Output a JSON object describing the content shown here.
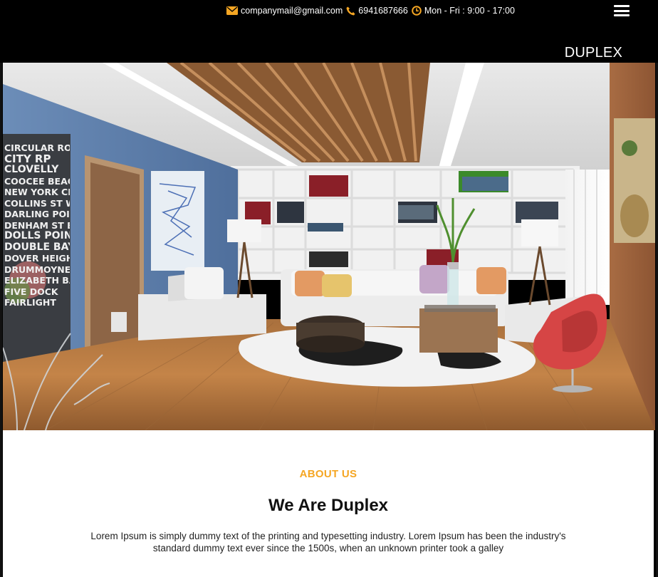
{
  "topbar": {
    "email": "companymail@gmail.com",
    "phone": "6941687666",
    "hours": "Mon - Fri : 9:00 - 17:00",
    "brand": "DUPLEX",
    "accent": "#f5a623",
    "icons": [
      "envelope-icon",
      "phone-icon",
      "clock-icon",
      "hamburger-menu-icon"
    ]
  },
  "hero": {
    "wall_art_words": [
      "CIRCULAR ROAD",
      "CITY RP",
      "CLOVELLY",
      "COOCEE BEACH",
      "NEW YORK CITY",
      "COLLINS ST WEST",
      "DARLING POINT",
      "DENHAM ST BOUND",
      "DOLLS POINT",
      "DOUBLE BAY",
      "DOVER HEIGHTS",
      "DRUMMOYNE",
      "ELIZABETH BAY",
      "FIVE DOCK",
      "FAIRLIGHT"
    ]
  },
  "about": {
    "kicker": "ABOUT US",
    "heading": "We Are Duplex",
    "text": "Lorem Ipsum is simply dummy text of the printing and typesetting industry. Lorem Ipsum has been the industry's standard dummy text ever since the 1500s, when an unknown printer took a galley"
  }
}
